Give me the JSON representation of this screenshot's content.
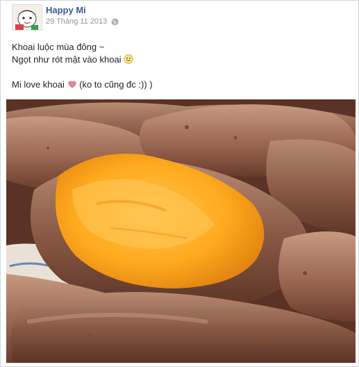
{
  "post": {
    "author": "Happy Mi",
    "date": "29 Tháng 11 2013",
    "privacy_icon": "globe-icon",
    "lines": {
      "line1": "Khoai luộc mùa đông ~",
      "line2_text": "Ngọt như rót mật vào khoai",
      "line2_emoji": "smile-emoji",
      "line3_before": "Mi love khoai",
      "line3_emoji": "heart-emoji",
      "line3_after": "(ko to cũng đc :)) )"
    },
    "photo": {
      "subject": "sweet-potatoes-photo"
    }
  },
  "colors": {
    "author_link": "#3b5998",
    "meta_text": "#90949c",
    "body_text": "#1d2129",
    "heart": "#e9839a",
    "border": "#d3d6db"
  }
}
